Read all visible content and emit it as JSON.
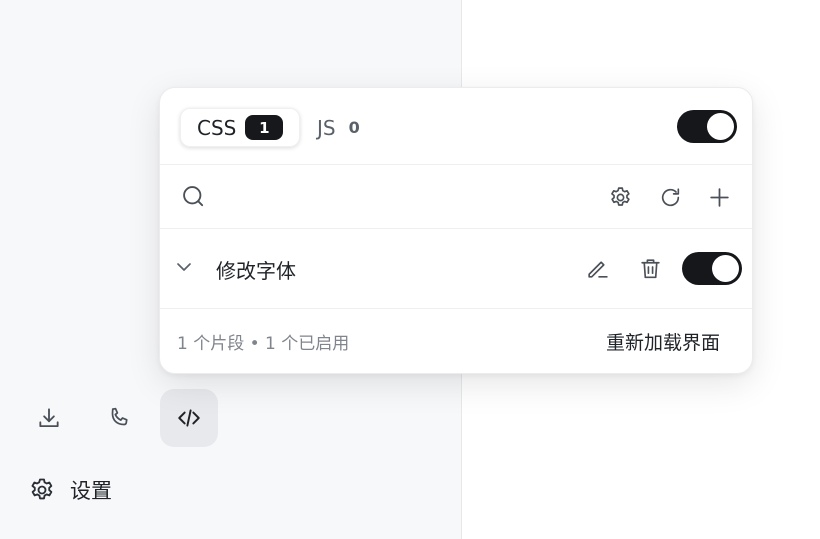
{
  "settings": {
    "label": "设置",
    "icon": "gear-icon"
  },
  "bottom_tools": [
    {
      "name": "download",
      "icon": "download-icon"
    },
    {
      "name": "phone",
      "icon": "phone-icon"
    },
    {
      "name": "code",
      "icon": "code-icon",
      "active": true
    }
  ],
  "popover": {
    "tabs": [
      {
        "label": "CSS",
        "count": "1",
        "active": true
      },
      {
        "label": "JS",
        "count": "0",
        "active": false
      }
    ],
    "master_toggle_on": true,
    "search": {
      "placeholder": ""
    },
    "snippets": [
      {
        "name": "修改字体",
        "enabled": true
      }
    ],
    "footer": {
      "status": "1 个片段 • 1 个已启用",
      "reload_label": "重新加载界面"
    }
  },
  "colors": {
    "toggle_on": "#15171b",
    "sidebar_bg": "#f7f8fa"
  }
}
